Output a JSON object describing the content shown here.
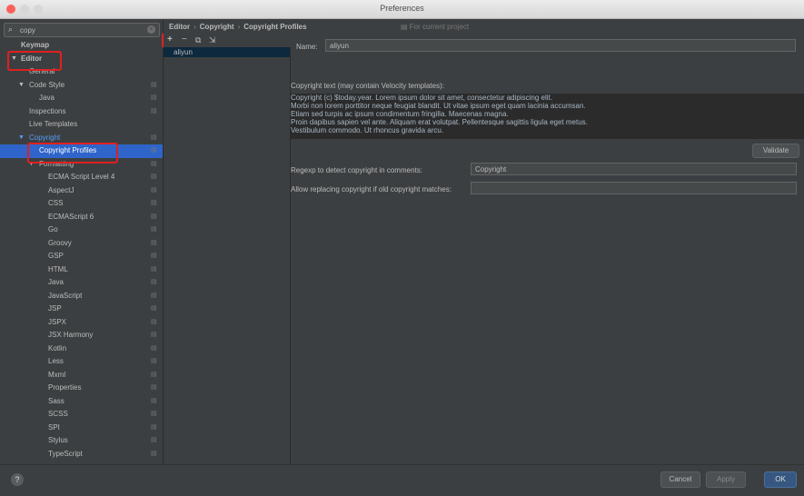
{
  "window": {
    "title": "Preferences"
  },
  "search": {
    "value": "copy",
    "clear_icon": "×"
  },
  "tree": [
    {
      "label": "Keymap",
      "indent": 0,
      "bold": true
    },
    {
      "label": "Editor",
      "indent": 0,
      "bold": true,
      "arrow": "▼"
    },
    {
      "label": "General",
      "indent": 1
    },
    {
      "label": "Code Style",
      "indent": 1,
      "arrow": "▼",
      "scoped": true
    },
    {
      "label": "Java",
      "indent": 2,
      "scoped": true
    },
    {
      "label": "Inspections",
      "indent": 1,
      "scoped": true
    },
    {
      "label": "Live Templates",
      "indent": 1
    },
    {
      "label": "Copyright",
      "indent": 1,
      "arrow": "▼",
      "scoped": true,
      "link": true
    },
    {
      "label": "Copyright Profiles",
      "indent": 2,
      "selected": true,
      "scoped": true
    },
    {
      "label": "Formatting",
      "indent": 2,
      "arrow": "▼",
      "scoped": true
    },
    {
      "label": "ECMA Script Level 4",
      "indent": 3,
      "scoped": true
    },
    {
      "label": "AspectJ",
      "indent": 3,
      "scoped": true
    },
    {
      "label": "CSS",
      "indent": 3,
      "scoped": true
    },
    {
      "label": "ECMAScript 6",
      "indent": 3,
      "scoped": true
    },
    {
      "label": "Go",
      "indent": 3,
      "scoped": true
    },
    {
      "label": "Groovy",
      "indent": 3,
      "scoped": true
    },
    {
      "label": "GSP",
      "indent": 3,
      "scoped": true
    },
    {
      "label": "HTML",
      "indent": 3,
      "scoped": true
    },
    {
      "label": "Java",
      "indent": 3,
      "scoped": true
    },
    {
      "label": "JavaScript",
      "indent": 3,
      "scoped": true
    },
    {
      "label": "JSP",
      "indent": 3,
      "scoped": true
    },
    {
      "label": "JSPX",
      "indent": 3,
      "scoped": true
    },
    {
      "label": "JSX Harmony",
      "indent": 3,
      "scoped": true
    },
    {
      "label": "Kotlin",
      "indent": 3,
      "scoped": true
    },
    {
      "label": "Less",
      "indent": 3,
      "scoped": true
    },
    {
      "label": "Mxml",
      "indent": 3,
      "scoped": true
    },
    {
      "label": "Properties",
      "indent": 3,
      "scoped": true
    },
    {
      "label": "Sass",
      "indent": 3,
      "scoped": true
    },
    {
      "label": "SCSS",
      "indent": 3,
      "scoped": true
    },
    {
      "label": "SPI",
      "indent": 3,
      "scoped": true
    },
    {
      "label": "Stylus",
      "indent": 3,
      "scoped": true
    },
    {
      "label": "TypeScript",
      "indent": 3,
      "scoped": true
    }
  ],
  "breadcrumb": {
    "part1": "Editor",
    "sep1": "›",
    "part2": "Copyright",
    "sep2": "›",
    "part3": "Copyright Profiles",
    "scope_note": "For current project"
  },
  "profile_toolbar": {
    "add": "+",
    "remove": "−",
    "copy": "⧉",
    "import": "⇲"
  },
  "profiles": [
    "aliyun"
  ],
  "detail": {
    "name_label": "Name:",
    "name_value": "aliyun",
    "text_label": "Copyright text (may contain Velocity templates):",
    "text_lines": [
      "Copyright (c) $today.year. Lorem ipsum dolor sit amet, consectetur adipiscing elit.",
      "Morbi non lorem porttitor neque feugiat blandit. Ut vitae ipsum eget quam lacinia accumsan.",
      "Etiam sed turpis ac ipsum condimentum fringilla. Maecenas magna.",
      "Proin dapibus sapien vel ante. Aliquam erat volutpat. Pellentesque sagittis ligula eget metus.",
      "Vestibulum commodo. Ut rhoncus gravida arcu."
    ],
    "validate_label": "Validate",
    "regexp_label": "Regexp to detect copyright in comments:",
    "regexp_value": "Copyright",
    "replace_label": "Allow replacing copyright if old copyright matches:",
    "replace_value": ""
  },
  "footer": {
    "help": "?",
    "cancel": "Cancel",
    "apply": "Apply",
    "ok": "OK"
  },
  "colors": {
    "accent": "#2f65ca",
    "highlight_box": "#e02020",
    "background": "#3c3f41"
  }
}
